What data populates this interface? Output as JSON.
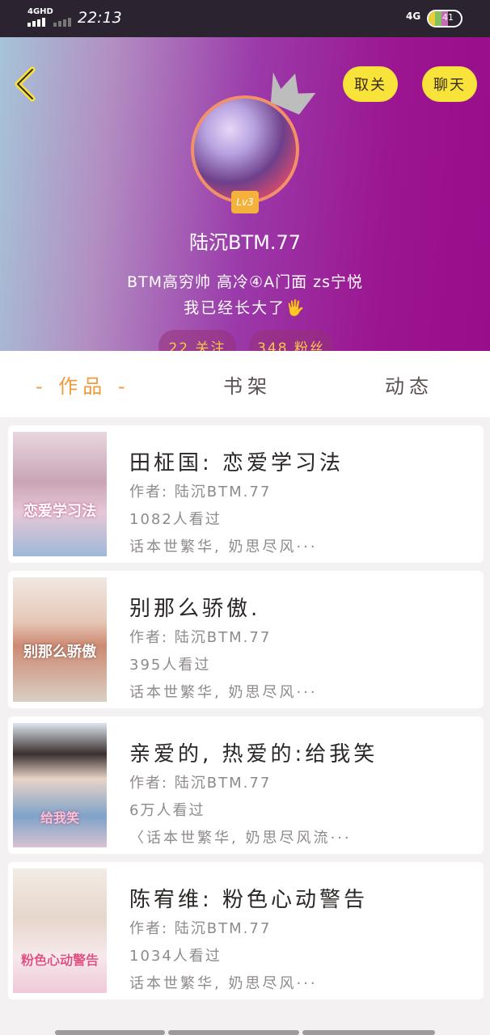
{
  "status_bar": {
    "network": "4GHD",
    "time": "22:13",
    "network_right": "4G",
    "battery": "41"
  },
  "header": {
    "back_icon": "chevron-left-icon",
    "unfollow_label": "取关",
    "chat_label": "聊天",
    "level": "Lv3",
    "nickname": "陆沉BTM.77",
    "bio_line1": "BTM高穷帅 高冷④A门面 zs宁悦",
    "bio_line2": "我已经长大了🖐",
    "following": "22 关注",
    "fans": "348 粉丝",
    "accent_color": "#f7e33a"
  },
  "tabs": [
    {
      "label": "- 作品 -",
      "active": true
    },
    {
      "label": "书架",
      "active": false
    },
    {
      "label": "动态",
      "active": false
    }
  ],
  "books": [
    {
      "title": "田柾国: 恋爱学习法",
      "author": "作者: 陆沉BTM.77",
      "views": "1082人看过",
      "desc": "话本世繁华, 奶思尽风···",
      "cover_text": "恋爱学习法"
    },
    {
      "title": "别那么骄傲.",
      "author": "作者: 陆沉BTM.77",
      "views": "395人看过",
      "desc": "话本世繁华, 奶思尽风···",
      "cover_text": "别那么骄傲"
    },
    {
      "title": "亲爱的, 热爱的:给我笑",
      "author": "作者: 陆沉BTM.77",
      "views": "6万人看过",
      "desc": "〈话本世繁华, 奶思尽风流···",
      "cover_text": "给我笑"
    },
    {
      "title": "陈宥维: 粉色心动警告",
      "author": "作者: 陆沉BTM.77",
      "views": "1034人看过",
      "desc": "话本世繁华, 奶思尽风···",
      "cover_text": "粉色心动警告"
    }
  ]
}
